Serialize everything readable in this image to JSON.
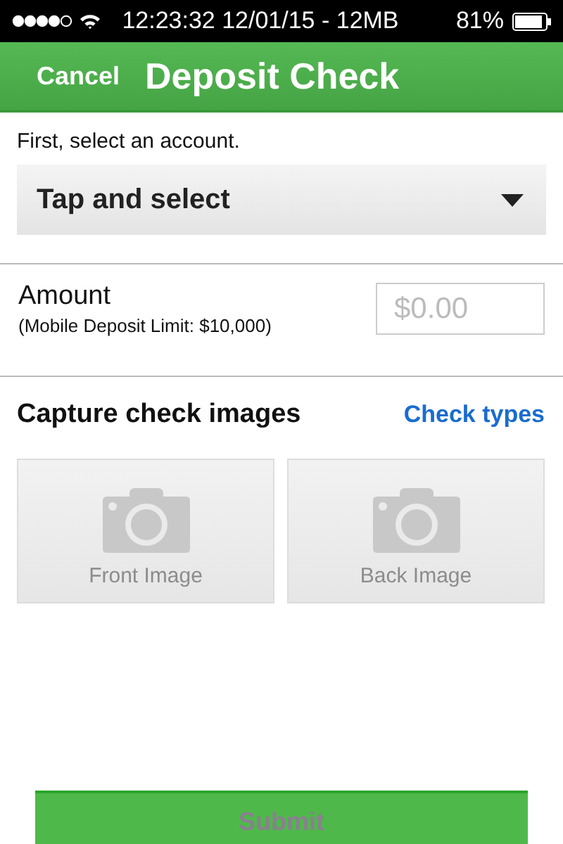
{
  "status_bar": {
    "time": "12:23:32 12/01/15 - 12MB",
    "battery": "81%"
  },
  "nav": {
    "cancel": "Cancel",
    "title": "Deposit Check"
  },
  "account": {
    "prompt": "First, select an account.",
    "dropdown": "Tap and select"
  },
  "amount": {
    "label": "Amount",
    "limit": "(Mobile Deposit Limit: $10,000)",
    "placeholder": "$0.00"
  },
  "capture": {
    "heading": "Capture check images",
    "link": "Check types",
    "tiles": [
      {
        "label": "Front Image"
      },
      {
        "label": "Back Image"
      }
    ]
  },
  "submit": {
    "label": "Submit",
    "disabled": true
  }
}
